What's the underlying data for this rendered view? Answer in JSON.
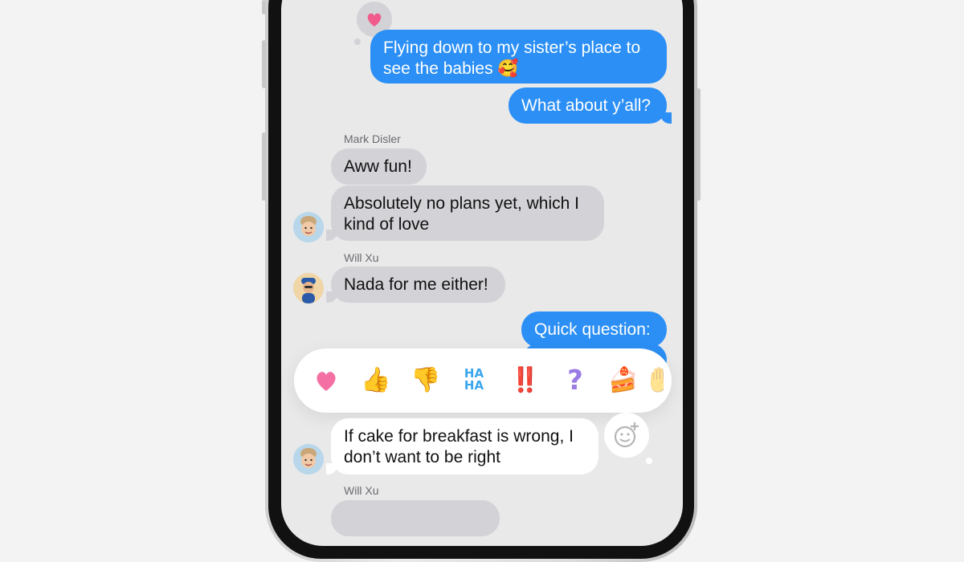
{
  "colors": {
    "outgoing": "#2b8ff5",
    "incoming": "#d2d2d7",
    "screen_bg": "#e9e9ea",
    "heart": "#f05b8b"
  },
  "messages": {
    "m1": "Flying down to my sister’s place to\nsee the babies 🥰",
    "m2": "What about y’all?",
    "sender_mark": "Mark Disler",
    "m3": "Aww fun!",
    "m4": "Absolutely no plans yet, which I\nkind of love",
    "sender_will": "Will Xu",
    "m5": "Nada for me either!",
    "m6": "Quick question:",
    "m7": "If cake for breakfast is wrong, I\ndon’t want to be right",
    "sender_will_2": "Will Xu"
  },
  "tapbacks": {
    "heart": "❤️",
    "thumbs_up": "👍",
    "thumbs_down": "👎",
    "haha": "HA HA",
    "exclaim": "‼️",
    "question": "?",
    "cake": "🍰",
    "partial": "✋"
  },
  "icons": {
    "heart_reaction": "heart-reaction-icon",
    "emoji_add": "emoji-add-icon",
    "avatar_mark": "memoji-avatar",
    "avatar_will": "memoji-avatar-will"
  }
}
